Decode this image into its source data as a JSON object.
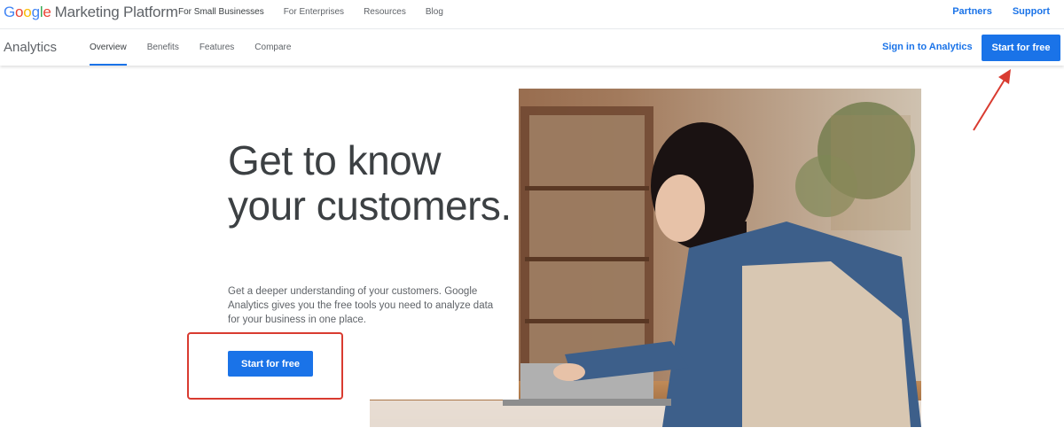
{
  "topbar": {
    "logo_google": "Google",
    "logo_platform": "Marketing Platform",
    "nav": [
      "For Small Businesses",
      "For Enterprises",
      "Resources",
      "Blog"
    ],
    "right_links": [
      "Partners",
      "Support"
    ]
  },
  "subnav": {
    "product": "Analytics",
    "tabs": [
      "Overview",
      "Benefits",
      "Features",
      "Compare"
    ],
    "signin": "Sign in to Analytics",
    "cta": "Start for free"
  },
  "hero": {
    "headline": "Get to know your customers.",
    "subtext": "Get a deeper understanding of your customers. Google Analytics gives you the free tools you need to analyze data for your business in one place.",
    "cta": "Start for free"
  },
  "colors": {
    "accent": "#1a73e8",
    "annotation": "#d93b30"
  }
}
